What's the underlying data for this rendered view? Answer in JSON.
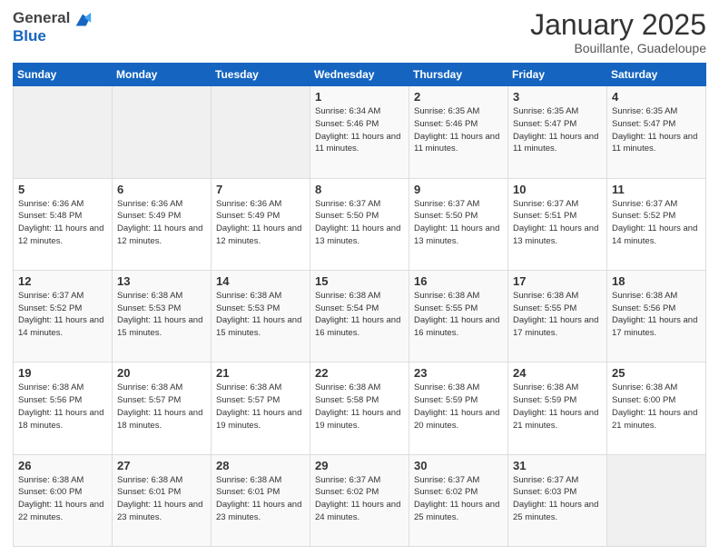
{
  "logo": {
    "general": "General",
    "blue": "Blue"
  },
  "header": {
    "month": "January 2025",
    "location": "Bouillante, Guadeloupe"
  },
  "days_of_week": [
    "Sunday",
    "Monday",
    "Tuesday",
    "Wednesday",
    "Thursday",
    "Friday",
    "Saturday"
  ],
  "weeks": [
    [
      {
        "day": "",
        "info": ""
      },
      {
        "day": "",
        "info": ""
      },
      {
        "day": "",
        "info": ""
      },
      {
        "day": "1",
        "info": "Sunrise: 6:34 AM\nSunset: 5:46 PM\nDaylight: 11 hours and 11 minutes."
      },
      {
        "day": "2",
        "info": "Sunrise: 6:35 AM\nSunset: 5:46 PM\nDaylight: 11 hours and 11 minutes."
      },
      {
        "day": "3",
        "info": "Sunrise: 6:35 AM\nSunset: 5:47 PM\nDaylight: 11 hours and 11 minutes."
      },
      {
        "day": "4",
        "info": "Sunrise: 6:35 AM\nSunset: 5:47 PM\nDaylight: 11 hours and 11 minutes."
      }
    ],
    [
      {
        "day": "5",
        "info": "Sunrise: 6:36 AM\nSunset: 5:48 PM\nDaylight: 11 hours and 12 minutes."
      },
      {
        "day": "6",
        "info": "Sunrise: 6:36 AM\nSunset: 5:49 PM\nDaylight: 11 hours and 12 minutes."
      },
      {
        "day": "7",
        "info": "Sunrise: 6:36 AM\nSunset: 5:49 PM\nDaylight: 11 hours and 12 minutes."
      },
      {
        "day": "8",
        "info": "Sunrise: 6:37 AM\nSunset: 5:50 PM\nDaylight: 11 hours and 13 minutes."
      },
      {
        "day": "9",
        "info": "Sunrise: 6:37 AM\nSunset: 5:50 PM\nDaylight: 11 hours and 13 minutes."
      },
      {
        "day": "10",
        "info": "Sunrise: 6:37 AM\nSunset: 5:51 PM\nDaylight: 11 hours and 13 minutes."
      },
      {
        "day": "11",
        "info": "Sunrise: 6:37 AM\nSunset: 5:52 PM\nDaylight: 11 hours and 14 minutes."
      }
    ],
    [
      {
        "day": "12",
        "info": "Sunrise: 6:37 AM\nSunset: 5:52 PM\nDaylight: 11 hours and 14 minutes."
      },
      {
        "day": "13",
        "info": "Sunrise: 6:38 AM\nSunset: 5:53 PM\nDaylight: 11 hours and 15 minutes."
      },
      {
        "day": "14",
        "info": "Sunrise: 6:38 AM\nSunset: 5:53 PM\nDaylight: 11 hours and 15 minutes."
      },
      {
        "day": "15",
        "info": "Sunrise: 6:38 AM\nSunset: 5:54 PM\nDaylight: 11 hours and 16 minutes."
      },
      {
        "day": "16",
        "info": "Sunrise: 6:38 AM\nSunset: 5:55 PM\nDaylight: 11 hours and 16 minutes."
      },
      {
        "day": "17",
        "info": "Sunrise: 6:38 AM\nSunset: 5:55 PM\nDaylight: 11 hours and 17 minutes."
      },
      {
        "day": "18",
        "info": "Sunrise: 6:38 AM\nSunset: 5:56 PM\nDaylight: 11 hours and 17 minutes."
      }
    ],
    [
      {
        "day": "19",
        "info": "Sunrise: 6:38 AM\nSunset: 5:56 PM\nDaylight: 11 hours and 18 minutes."
      },
      {
        "day": "20",
        "info": "Sunrise: 6:38 AM\nSunset: 5:57 PM\nDaylight: 11 hours and 18 minutes."
      },
      {
        "day": "21",
        "info": "Sunrise: 6:38 AM\nSunset: 5:57 PM\nDaylight: 11 hours and 19 minutes."
      },
      {
        "day": "22",
        "info": "Sunrise: 6:38 AM\nSunset: 5:58 PM\nDaylight: 11 hours and 19 minutes."
      },
      {
        "day": "23",
        "info": "Sunrise: 6:38 AM\nSunset: 5:59 PM\nDaylight: 11 hours and 20 minutes."
      },
      {
        "day": "24",
        "info": "Sunrise: 6:38 AM\nSunset: 5:59 PM\nDaylight: 11 hours and 21 minutes."
      },
      {
        "day": "25",
        "info": "Sunrise: 6:38 AM\nSunset: 6:00 PM\nDaylight: 11 hours and 21 minutes."
      }
    ],
    [
      {
        "day": "26",
        "info": "Sunrise: 6:38 AM\nSunset: 6:00 PM\nDaylight: 11 hours and 22 minutes."
      },
      {
        "day": "27",
        "info": "Sunrise: 6:38 AM\nSunset: 6:01 PM\nDaylight: 11 hours and 23 minutes."
      },
      {
        "day": "28",
        "info": "Sunrise: 6:38 AM\nSunset: 6:01 PM\nDaylight: 11 hours and 23 minutes."
      },
      {
        "day": "29",
        "info": "Sunrise: 6:37 AM\nSunset: 6:02 PM\nDaylight: 11 hours and 24 minutes."
      },
      {
        "day": "30",
        "info": "Sunrise: 6:37 AM\nSunset: 6:02 PM\nDaylight: 11 hours and 25 minutes."
      },
      {
        "day": "31",
        "info": "Sunrise: 6:37 AM\nSunset: 6:03 PM\nDaylight: 11 hours and 25 minutes."
      },
      {
        "day": "",
        "info": ""
      }
    ]
  ]
}
